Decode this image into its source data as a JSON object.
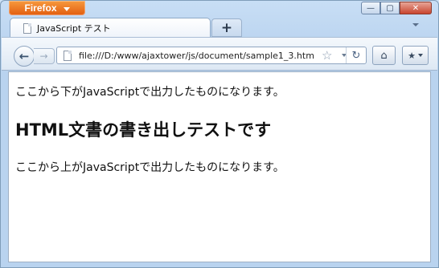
{
  "titlebar": {
    "app_button_label": "Firefox",
    "minimize_glyph": "—",
    "maximize_glyph": "▢",
    "close_glyph": "✕"
  },
  "tabs": [
    {
      "label": "JavaScript テスト"
    }
  ],
  "new_tab_glyph": "+",
  "toolbar": {
    "back_glyph": "←",
    "forward_glyph": "→",
    "url": "file:///D:/www/ajaxtower/js/document/sample1_3.htm",
    "star_glyph": "☆",
    "reload_glyph": "↻",
    "home_glyph": "⌂",
    "bookmarks_glyph": "★"
  },
  "page": {
    "line_before": "ここから下がJavaScriptで出力したものになります。",
    "heading": "HTML文書の書き出しテストです",
    "line_after": "ここから上がJavaScriptで出力したものになります。"
  }
}
